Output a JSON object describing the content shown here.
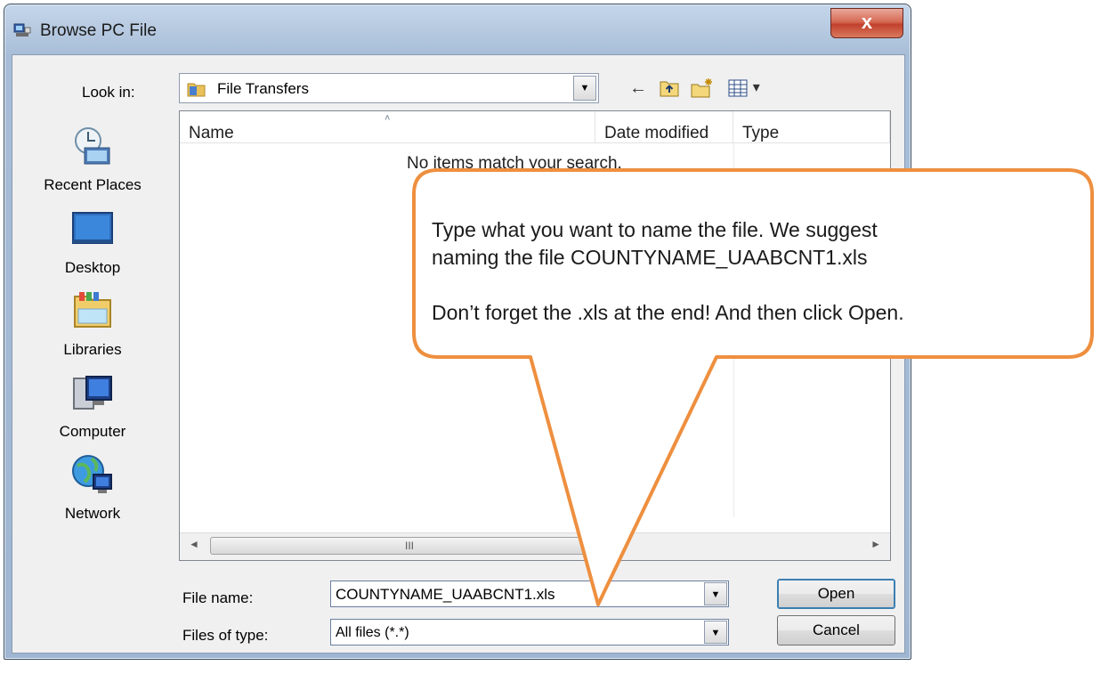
{
  "window": {
    "title": "Browse PC File",
    "close_glyph": "x"
  },
  "lookin": {
    "label": "Look in:",
    "value": "File Transfers"
  },
  "toolbar": {
    "back_icon": "back-arrow-icon",
    "back_glyph": "←",
    "up_icon": "up-folder-icon",
    "new_folder_icon": "new-folder-icon",
    "view_menu_icon": "view-menu-icon",
    "view_caret": "▾"
  },
  "places": [
    {
      "label": "Recent Places",
      "icon": "recent-places-icon"
    },
    {
      "label": "Desktop",
      "icon": "desktop-icon"
    },
    {
      "label": "Libraries",
      "icon": "libraries-icon"
    },
    {
      "label": "Computer",
      "icon": "computer-icon"
    },
    {
      "label": "Network",
      "icon": "network-icon"
    }
  ],
  "file_list": {
    "columns": [
      "Name",
      "Date modified",
      "Type"
    ],
    "sort_indicator": "˄",
    "empty_message": "No items match your search.",
    "scroll_left": "◄",
    "scroll_right": "►",
    "scroll_grip": "III"
  },
  "file_name": {
    "label": "File name:",
    "value": "COUNTYNAME_UAABCNT1.xls"
  },
  "file_type": {
    "label": "Files of type:",
    "value": "All files (*.*)"
  },
  "dropdown_glyph": "▼",
  "buttons": {
    "open": "Open",
    "cancel": "Cancel"
  },
  "callout": {
    "text": "Type what you want to name the file.  We suggest\nnaming the file  COUNTYNAME_UAABCNT1.xls\n\nDon’t forget the .xls at the end!  And then click Open.",
    "border_color": "#ee8f3f"
  },
  "colors": {
    "title_bar": "#b6c9e0",
    "close_button": "#c2412c",
    "dialog_bg": "#f0f0f0"
  }
}
